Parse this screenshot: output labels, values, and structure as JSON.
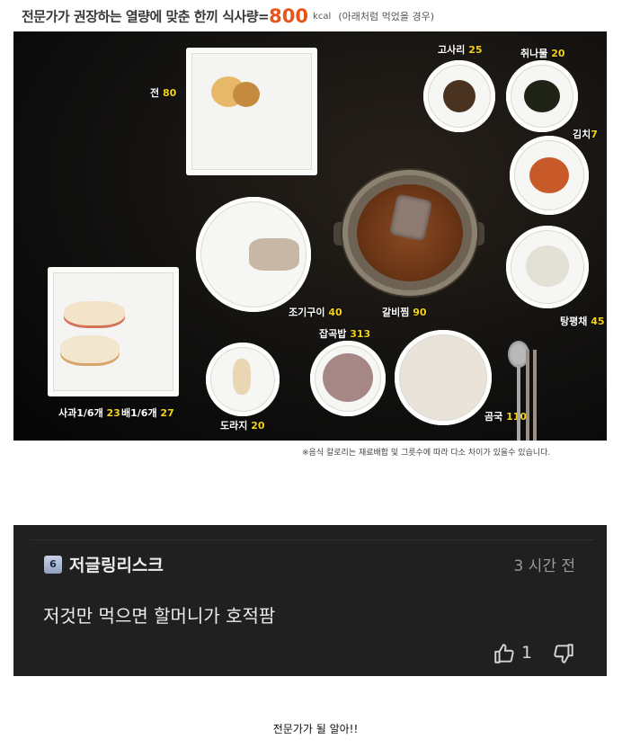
{
  "infographic": {
    "headline_main": "전문가가 권장하는 열량에 맞춘 한끼 식사량=",
    "headline_kcal": "800",
    "headline_unit": "kcal",
    "headline_note": "(아래처럼 먹었을 경우)",
    "foods": [
      {
        "name": "전",
        "kcal": "80"
      },
      {
        "name": "고사리",
        "kcal": "25"
      },
      {
        "name": "취나물",
        "kcal": "20"
      },
      {
        "name": "김치",
        "kcal": "7"
      },
      {
        "name": "조기구이",
        "kcal": "40"
      },
      {
        "name": "갈비찜",
        "kcal": "90"
      },
      {
        "name": "탕평채",
        "kcal": "45"
      },
      {
        "name": "잡곡밥",
        "kcal": "313"
      },
      {
        "name": "사과1/6개",
        "kcal": "23"
      },
      {
        "name": "배1/6개",
        "kcal": "27"
      },
      {
        "name": "도라지",
        "kcal": "20"
      },
      {
        "name": "곰국",
        "kcal": "110"
      }
    ],
    "footnote": "※음식 칼로리는 재료배합 및 그릇수에 따라 다소 차이가 있을수 있습니다."
  },
  "comment": {
    "level_badge": "6",
    "username": "저글링리스크",
    "time": "3 시간 전",
    "text": "저것만 먹으면 할머니가 호적팜",
    "like_count": "1",
    "icons": {
      "like": "thumbs-up-icon",
      "dislike": "thumbs-down-icon"
    }
  },
  "caption": "전문가가 될 알아!!"
}
